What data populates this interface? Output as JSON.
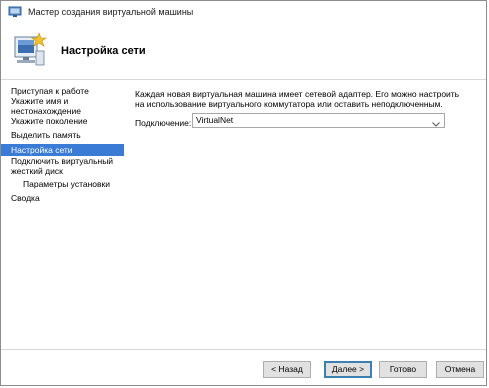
{
  "window": {
    "title": "Мастер создания виртуальной машины",
    "page_title": "Настройка сети",
    "accent_color": "#3a7bd5"
  },
  "steps": [
    {
      "label": "Приступая к работе",
      "active": false,
      "sub": false
    },
    {
      "label": "Укажите имя и",
      "active": false,
      "sub": false
    },
    {
      "label": "нестонахождение",
      "active": false,
      "sub": false
    },
    {
      "label": "Укажите поколение",
      "active": false,
      "sub": false
    },
    {
      "label": "Выделить память",
      "active": false,
      "sub": false
    },
    {
      "label": "Настройка сети",
      "active": true,
      "sub": false
    },
    {
      "label": "Подключить виртуальный",
      "active": false,
      "sub": false
    },
    {
      "label": "жесткий диск",
      "active": false,
      "sub": false
    },
    {
      "label": "Параметры установки",
      "active": false,
      "sub": true
    },
    {
      "label": "Сводка",
      "active": false,
      "sub": false
    }
  ],
  "content": {
    "description": "Каждая новая виртуальная машина имеет сетевой адаптер. Его можно настроить на использование виртуального коммутатора или оставить неподключенным.",
    "connection_label": "Подключение:",
    "connection_value": "VirtualNet"
  },
  "buttons": {
    "back": "< Назад",
    "next": "Далее >",
    "finish": "Готово",
    "cancel": "Отмена"
  },
  "icons": {
    "app": "hyperv-window-icon",
    "wizard": "monitor-star-icon",
    "dropdown": "chevron-down-icon"
  }
}
